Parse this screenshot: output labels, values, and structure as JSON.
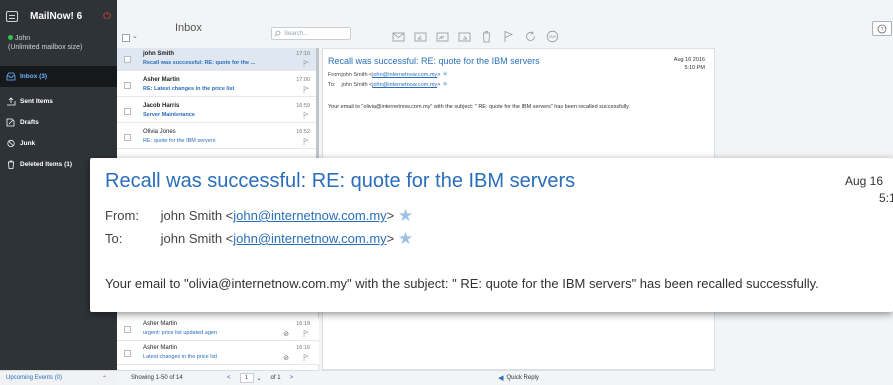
{
  "app": {
    "name": "MailNow! 6"
  },
  "user": {
    "name": "John",
    "status": "(Unlimited mailbox size)"
  },
  "folders": [
    {
      "label": "Inbox (3)",
      "icon": "inbox-icon"
    },
    {
      "label": "Sent Items",
      "icon": "sent-icon"
    },
    {
      "label": "Drafts",
      "icon": "drafts-icon"
    },
    {
      "label": "Junk",
      "icon": "junk-icon"
    },
    {
      "label": "Deleted Items (1)",
      "icon": "trash-icon"
    }
  ],
  "sidebar_footer": {
    "label": "Upcoming Events (0)",
    "toggle": "⌃"
  },
  "list": {
    "title": "Inbox",
    "search_placeholder": "Search...",
    "emails": [
      {
        "from": "john Smith",
        "subject": "Recall was successful: RE: quote for the ...",
        "time": "17:10"
      },
      {
        "from": "Asher Martin",
        "subject": "RE: Latest changes in the price list",
        "time": "17:00"
      },
      {
        "from": "Jacob Harris",
        "subject": "Server Maintenance",
        "time": "16:59"
      },
      {
        "from": "Olivia Jones",
        "subject": "RE: quote for the IBM servers",
        "time": "16:52"
      },
      {
        "from": "Asher Martin",
        "subject": "urgent: price list updated agen",
        "time": "16:18"
      },
      {
        "from": "Asher Martin",
        "subject": "Latest changes in the price list",
        "time": "16:16"
      }
    ],
    "pager": {
      "text": "Showing 1-50 of 14",
      "prev": "<",
      "page": "1",
      "of": "of 1",
      "next": ">"
    }
  },
  "message": {
    "subject": "Recall was successful: RE: quote for the IBM servers",
    "date": "Aug 16 2016",
    "time": "5:10 PM",
    "from_label": "From:",
    "from_name": "john Smith",
    "from_email": "john@internetnow.com.my",
    "to_label": "To:",
    "to_name": "john Smith",
    "to_email": "john@internetnow.com.my",
    "body": "Your email to \"olivia@internetnow.com.my\" with the subject: \" RE: quote for the IBM servers\" has been recalled successfully."
  },
  "callout": {
    "subject": "Recall was successful: RE: quote for the IBM servers",
    "date_line1": "Aug 16",
    "date_line2": "5:1",
    "from_label": "From:",
    "to_label": "To:",
    "name": "john Smith",
    "email": "john@internetnow.com.my",
    "body": "Your email to \"olivia@internetnow.com.my\" with the subject: \" RE: quote for the IBM servers\" has been recalled successfully."
  },
  "quick_reply": {
    "label": "Quick Reply"
  },
  "colors": {
    "sidebar": "#2e3338",
    "accent": "#2a6ebb",
    "selected_row": "#dfe7f0"
  }
}
